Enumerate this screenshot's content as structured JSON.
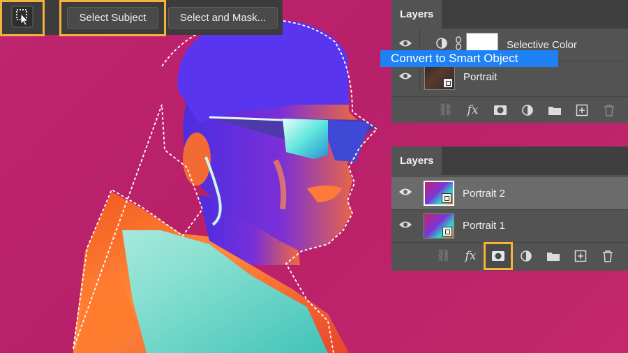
{
  "toolbar": {
    "select_subject_label": "Select Subject",
    "select_and_mask_label": "Select and Mask...",
    "tool_icon": "quick-selection-tool-icon"
  },
  "layers_panel_top": {
    "tab_label": "Layers",
    "layers": [
      {
        "name": "Selective Color",
        "type": "adjustment",
        "visible": true
      },
      {
        "name": "Portrait",
        "type": "smart-object",
        "visible": true
      }
    ],
    "context_menu_item": "Convert to Smart Object"
  },
  "layers_panel_bottom": {
    "tab_label": "Layers",
    "layers": [
      {
        "name": "Portrait 2",
        "type": "smart-object",
        "visible": true,
        "selected": true
      },
      {
        "name": "Portrait 1",
        "type": "smart-object",
        "visible": true,
        "selected": false
      }
    ]
  },
  "colors": {
    "background": "#c0246e",
    "highlight": "#f5b33a",
    "panel": "#535353",
    "tooltip": "#1f82f4"
  }
}
